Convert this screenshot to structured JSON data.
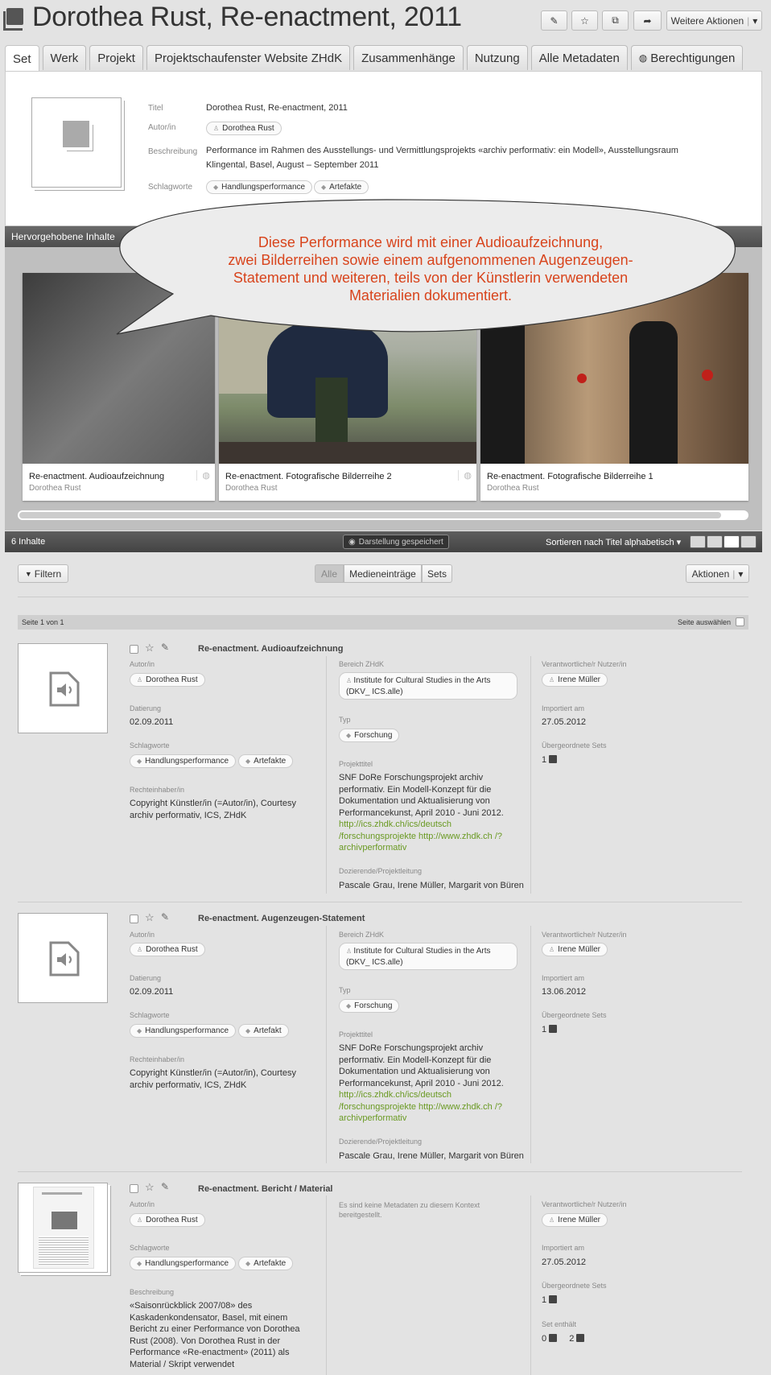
{
  "title": "Dorothea Rust, Re-enactment, 2011",
  "toolbar": {
    "edit": "✎",
    "favorite": "☆",
    "move": "⧉",
    "share": "➦",
    "more": "Weitere Aktionen"
  },
  "tabs": [
    "Set",
    "Werk",
    "Projekt",
    "Projektschaufenster Website ZHdK",
    "Zusammenhänge",
    "Nutzung",
    "Alle Metadaten",
    "Berechtigungen"
  ],
  "meta": {
    "titel_label": "Titel",
    "titel": "Dorothea Rust, Re-enactment, 2011",
    "autor_label": "Autor/in",
    "autor": "Dorothea Rust",
    "beschreibung_label": "Beschreibung",
    "beschreibung_1": "Performance im Rahmen des Ausstellungs- und Vermittlungsprojekts «archiv performativ: ein Modell», Ausstellungsraum",
    "beschreibung_2": "Klingental, Basel, August – September 2011",
    "schlagworte_label": "Schlagworte",
    "schlagwort_1": "Handlungsperformance",
    "schlagwort_2": "Artefakte"
  },
  "highlight": {
    "header": "Hervorgehobene Inhalte",
    "bubble": [
      "Diese Performance wird mit einer Audioaufzeichnung,",
      "zwei Bilderreihen sowie einem aufgenommenen Augenzeugen-",
      "Statement und weiteren, teils von der Künstlerin verwendeten",
      "Materialien dokumentiert."
    ],
    "cards": [
      {
        "title": "Re-enactment. Audioaufzeichnung",
        "author": "Dorothea Rust"
      },
      {
        "title": "Re-enactment. Fotografische Bilderreihe 2",
        "author": "Dorothea Rust"
      },
      {
        "title": "Re-enactment. Fotografische Bilderreihe 1",
        "author": "Dorothea Rust"
      }
    ]
  },
  "listbar": {
    "count": "6 Inhalte",
    "saved": "Darstellung gespeichert",
    "sort": "Sortieren nach Titel alphabetisch"
  },
  "filterbar": {
    "filter": "Filtern",
    "all": "Alle",
    "media": "Medieneinträge",
    "sets": "Sets",
    "actions": "Aktionen"
  },
  "pagination": {
    "page": "Seite 1 von 1",
    "select": "Seite auswählen"
  },
  "labels": {
    "autor": "Autor/in",
    "datierung": "Datierung",
    "schlagworte": "Schlagworte",
    "rechte": "Rechteinhaber/in",
    "bereich": "Bereich ZHdK",
    "typ": "Typ",
    "projekttitel": "Projekttitel",
    "dozierende": "Dozierende/Projektleitung",
    "verantwortlich": "Verantwortliche/r Nutzer/in",
    "importiert": "Importiert am",
    "sets": "Übergeordnete Sets",
    "beschreibung": "Beschreibung",
    "set_enthaelt": "Set enthält",
    "no_meta": "Es sind keine Metadaten zu diesem Kontext bereitgestellt."
  },
  "entries": [
    {
      "title": "Re-enactment. Audioaufzeichnung",
      "autor": "Dorothea Rust",
      "datierung": "02.09.2011",
      "schlagwort_1": "Handlungsperformance",
      "schlagwort_2": "Artefakte",
      "rechte": "Copyright Künstler/in (=Autor/in), Courtesy archiv performativ, ICS, ZHdK",
      "bereich": "Institute for Cultural Studies in the Arts (DKV_ ICS.alle)",
      "typ": "Forschung",
      "projekttitel": "SNF DoRe Forschungsprojekt archiv performativ. Ein Modell-Konzept für die Dokumentation und Aktualisierung von Performancekunst, April 2010 - Juni 2012.",
      "link": "http://ics.zhdk.ch/ics/deutsch /forschungsprojekte http://www.zhdk.ch /?archivperformativ",
      "dozierende": "Pascale Grau, Irene Müller, Margarit von Büren",
      "nutzer": "Irene Müller",
      "importiert": "27.05.2012",
      "sets": "1"
    },
    {
      "title": "Re-enactment. Augenzeugen-Statement",
      "autor": "Dorothea Rust",
      "datierung": "02.09.2011",
      "schlagwort_1": "Handlungsperformance",
      "schlagwort_2": "Artefakt",
      "rechte": "Copyright Künstler/in (=Autor/in), Courtesy archiv performativ, ICS, ZHdK",
      "bereich": "Institute for Cultural Studies in the Arts (DKV_ ICS.alle)",
      "typ": "Forschung",
      "projekttitel": "SNF DoRe Forschungsprojekt archiv performativ. Ein Modell-Konzept für die Dokumentation und Aktualisierung von Performancekunst, April 2010 - Juni 2012.",
      "link": "http://ics.zhdk.ch/ics/deutsch /forschungsprojekte http://www.zhdk.ch /?archivperformativ",
      "dozierende": "Pascale Grau, Irene Müller, Margarit von Büren",
      "nutzer": "Irene Müller",
      "importiert": "13.06.2012",
      "sets": "1"
    },
    {
      "title": "Re-enactment. Bericht / Material",
      "autor": "Dorothea Rust",
      "schlagwort_1": "Handlungsperformance",
      "schlagwort_2": "Artefakte",
      "beschreibung": "«Saisonrückblick 2007/08» des Kaskadenkondensator, Basel, mit einem Bericht zu einer Performance von Dorothea Rust (2008). Von Dorothea Rust in der Performance «Re-enactment» (2011) als Material / Skript verwendet",
      "nutzer": "Irene Müller",
      "importiert": "27.05.2012",
      "sets": "1",
      "enthaelt_a": "0",
      "enthaelt_b": "2"
    }
  ]
}
